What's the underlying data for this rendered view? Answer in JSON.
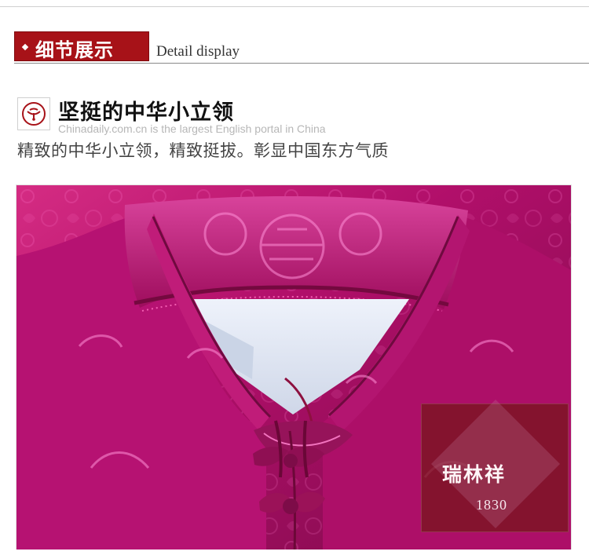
{
  "header": {
    "title": "细节展示",
    "subtitle": "Detail display"
  },
  "section": {
    "title": "坚挺的中华小立领",
    "caption": "Chinadaily.com.cn is the largest English portal in China",
    "description": "精致的中华小立领，精致挺拔。彰显中国东方气质",
    "icon": "collar-icon"
  },
  "photo": {
    "subject": "purple silk jacket collar",
    "brand_name": "瑞林祥",
    "brand_year": "1830",
    "colors": {
      "fabric_main": "#b10f6a",
      "fabric_dark": "#7f0d4a",
      "fabric_light": "#d02b80",
      "lining": "#dfe4ef"
    }
  }
}
